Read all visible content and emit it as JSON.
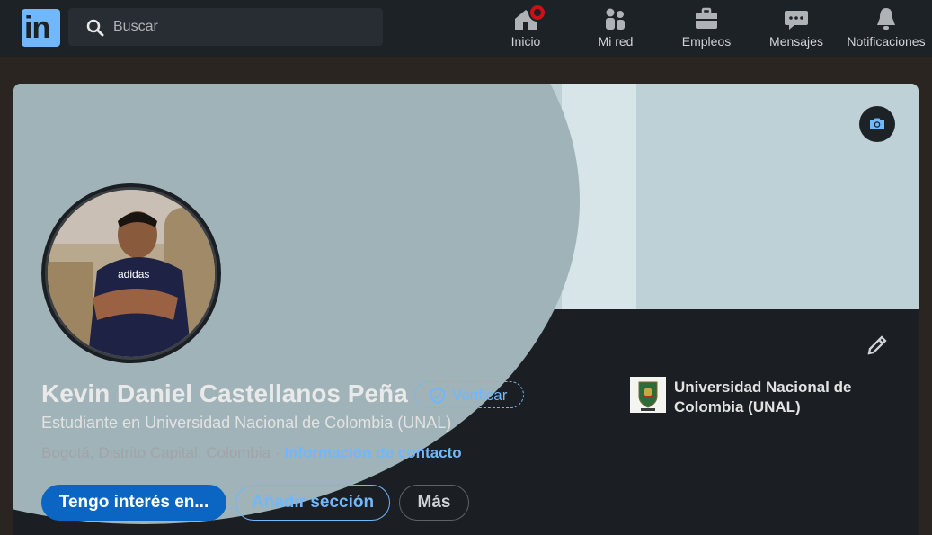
{
  "nav": {
    "logo_text": "in",
    "search_placeholder": "Buscar",
    "items": [
      {
        "label": "Inicio",
        "icon": "home-icon"
      },
      {
        "label": "Mi red",
        "icon": "people-icon"
      },
      {
        "label": "Empleos",
        "icon": "briefcase-icon"
      },
      {
        "label": "Mensajes",
        "icon": "chat-icon"
      },
      {
        "label": "Notificaciones",
        "icon": "bell-icon"
      }
    ]
  },
  "profile": {
    "name": "Kevin Daniel Castellanos Peña",
    "verify_label": "Verificar",
    "headline": "Estudiante en Universidad Nacional de Colombia (UNAL)",
    "location": "Bogotá, Distrito Capital, Colombia · ",
    "contact_link": "Información de contacto",
    "education": "Universidad Nacional de Colombia (UNAL)"
  },
  "actions": {
    "primary": "Tengo interés en...",
    "add_section": "Añadir sección",
    "more": "Más"
  },
  "colors": {
    "accent": "#71b7fb",
    "primary_button": "#0a66c2",
    "nav_bg": "#1d2226",
    "card_bg": "#1b1f23",
    "notification": "#cc1016"
  }
}
